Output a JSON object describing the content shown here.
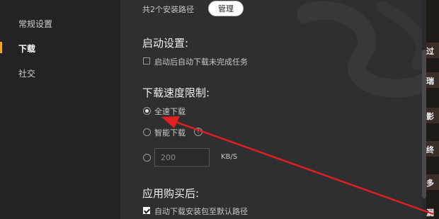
{
  "sidebar": {
    "items": [
      {
        "label": "常规设置",
        "active": false
      },
      {
        "label": "下载",
        "active": true
      },
      {
        "label": "社交",
        "active": false
      }
    ]
  },
  "install": {
    "path_text": "共2个安装路径",
    "manage_label": "管理"
  },
  "startup": {
    "heading": "启动设置:",
    "option_label": "启动后自动下载未完成任务",
    "option_checked": false
  },
  "speed": {
    "heading": "下载速度限制:",
    "options": [
      {
        "label": "全速下载",
        "selected": true
      },
      {
        "label": "智能下载",
        "selected": false
      }
    ],
    "custom_value": "200",
    "unit": "KB/S"
  },
  "purchase": {
    "heading": "应用购买后:",
    "option_label": "自动下载安装包至默认路径",
    "option_checked": true
  },
  "side_panel_glyphs": [
    "过",
    "瑞",
    "影",
    "终",
    "多",
    "漏"
  ],
  "colors": {
    "accent": "#f5a623",
    "annotation_arrow": "#e02020",
    "background": "#2f2f31",
    "sidebar_bg": "#232325"
  }
}
